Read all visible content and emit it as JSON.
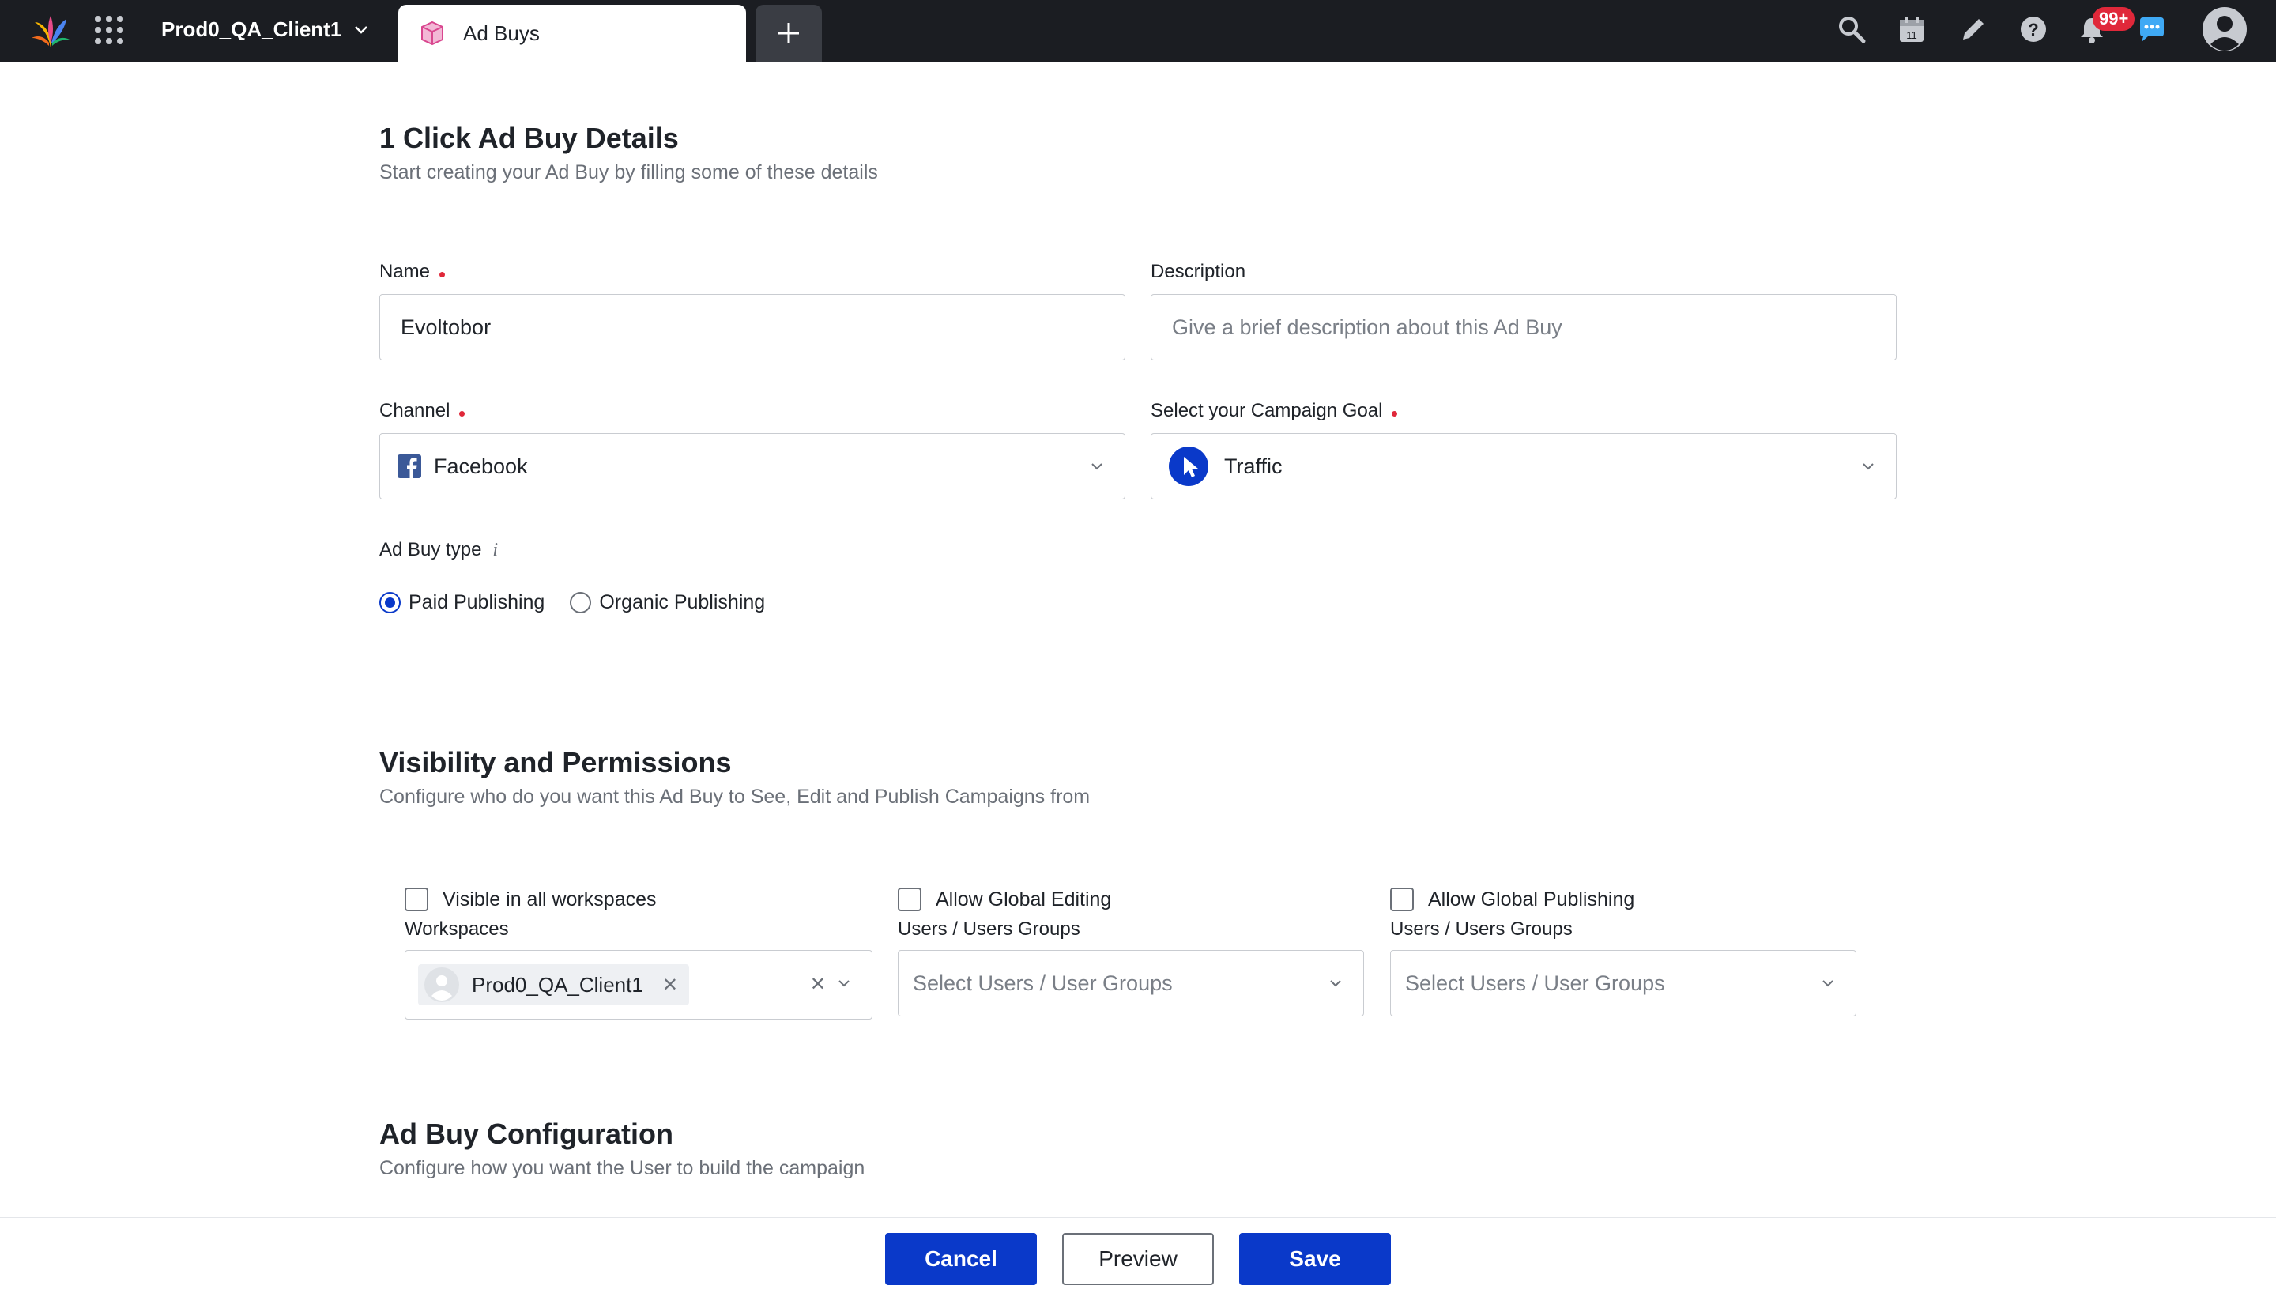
{
  "topbar": {
    "client_name": "Prod0_QA_Client1",
    "tab_label": "Ad Buys",
    "notification_badge": "99+",
    "icons": [
      "search-icon",
      "calendar-icon",
      "pencil-icon",
      "help-icon",
      "bell-icon",
      "chat-icon",
      "user-icon"
    ],
    "calendar_day": "11"
  },
  "details": {
    "title": "1 Click Ad Buy Details",
    "subtitle": "Start creating your Ad Buy by filling some of these details",
    "name_label": "Name",
    "name_value": "Evoltobor",
    "description_label": "Description",
    "description_placeholder": "Give a brief description about this Ad Buy",
    "channel_label": "Channel",
    "channel_value": "Facebook",
    "goal_label": "Select your Campaign Goal",
    "goal_value": "Traffic",
    "adbuy_type_label": "Ad Buy type",
    "adbuy_type_info": "i",
    "adbuy_type_options": [
      "Paid Publishing",
      "Organic Publishing"
    ],
    "adbuy_type_selected": "Paid Publishing"
  },
  "visibility": {
    "title": "Visibility and Permissions",
    "subtitle": "Configure who do you want this Ad Buy to See, Edit and Publish Campaigns from",
    "visible_all_label": "Visible in all workspaces",
    "workspaces_label": "Workspaces",
    "workspace_chip": "Prod0_QA_Client1",
    "global_editing_label": "Allow Global Editing",
    "editing_users_label": "Users / Users Groups",
    "editing_placeholder": "Select Users / User Groups",
    "global_publishing_label": "Allow Global Publishing",
    "publishing_users_label": "Users / Users Groups",
    "publishing_placeholder": "Select Users / User Groups"
  },
  "configuration": {
    "title": "Ad Buy Configuration",
    "subtitle": "Configure how you want the User to build the campaign"
  },
  "footer": {
    "cancel": "Cancel",
    "preview": "Preview",
    "save": "Save"
  },
  "colors": {
    "topbar": "#1b1d22",
    "primary": "#0a39c9",
    "required": "#e0283a",
    "badge": "#e0283a",
    "chat": "#3fa9f5"
  }
}
